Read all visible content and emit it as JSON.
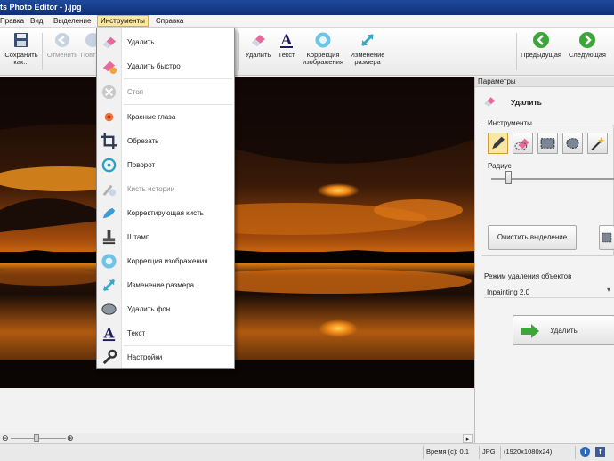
{
  "window": {
    "title": "ts Photo Editor - ).jpg"
  },
  "menu": [
    {
      "label": "Правка",
      "active": false
    },
    {
      "label": "Вид",
      "active": false
    },
    {
      "label": "Выделение",
      "active": false
    },
    {
      "label": "Инструменты",
      "active": true
    },
    {
      "label": "Справка",
      "active": false
    }
  ],
  "toolbar": {
    "save": "Сохранить как...",
    "undo": "Отменить",
    "redo": "Повт",
    "remove": "Удалить",
    "text": "Текст",
    "correction": "Коррекция изображения",
    "resize": "Изменение размера",
    "prev": "Предыдущая",
    "next": "Следующая"
  },
  "dropdown": {
    "items": [
      {
        "label": "Удалить",
        "icon": "eraser-icon",
        "dim": false
      },
      {
        "label": "Удалить быстро",
        "icon": "eraser-clock-icon",
        "dim": false
      },
      {
        "label": "Стоп",
        "icon": "stop-icon",
        "dim": true
      },
      {
        "label": "Красные глаза",
        "icon": "red-eye-icon",
        "dim": false
      },
      {
        "label": "Обрезать",
        "icon": "crop-icon",
        "dim": false
      },
      {
        "label": "Поворот",
        "icon": "rotate-icon",
        "dim": false
      },
      {
        "label": "Кисть истории",
        "icon": "history-brush-icon",
        "dim": true
      },
      {
        "label": "Корректирующая кисть",
        "icon": "correction-brush-icon",
        "dim": false
      },
      {
        "label": "Штамп",
        "icon": "stamp-icon",
        "dim": false
      },
      {
        "label": "Коррекция изображения",
        "icon": "image-correction-icon",
        "dim": false
      },
      {
        "label": "Изменение размера",
        "icon": "resize-icon",
        "dim": false
      },
      {
        "label": "Удалить фон",
        "icon": "remove-background-icon",
        "dim": false
      },
      {
        "label": "Текст",
        "icon": "text-icon",
        "dim": false
      },
      {
        "label": "Настройки",
        "icon": "wrench-icon",
        "dim": false
      }
    ]
  },
  "panel": {
    "header": "Параметры",
    "tool_title": "Удалить",
    "tools_group": "Инструменты",
    "radius_label": "Радиус",
    "radius_level": 0.14,
    "clear_selection": "Очистить выделение",
    "mode_label": "Режим удаления объектов",
    "mode_value": "Inpainting 2.0",
    "remove_button": "Удалить"
  },
  "status": {
    "time": "Время (с): 0.1",
    "format": "JPG",
    "dimensions": "(1920x1080x24)"
  },
  "colors": {
    "accent": "#f6e9a6",
    "title": "#1f4a9c",
    "green": "#3ea53a"
  }
}
